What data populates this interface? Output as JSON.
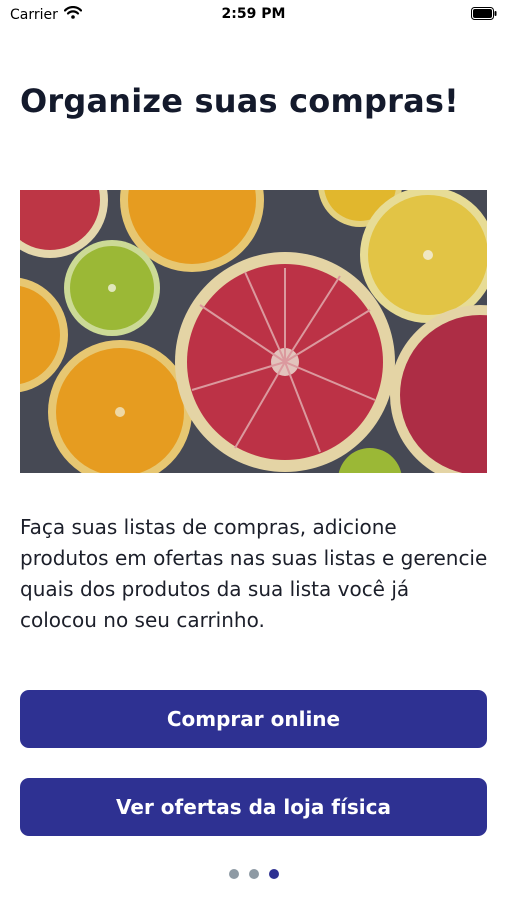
{
  "status_bar": {
    "carrier": "Carrier",
    "time": "2:59 PM"
  },
  "screen": {
    "title": "Organize suas compras!",
    "description": "Faça suas listas de compras, adicione produtos em ofertas nas suas listas e gerencie quais dos produtos da sua lista você já colocou no seu carrinho.",
    "buttons": {
      "buy_online": "Comprar online",
      "store_offers": "Ver ofertas da loja física"
    },
    "pager": {
      "total": 3,
      "active": 3
    }
  },
  "colors": {
    "primary": "#2e3192",
    "dot_inactive": "#8e9aa4",
    "title_text": "#141a2c"
  },
  "icons": [
    "wifi-icon",
    "battery-icon"
  ]
}
